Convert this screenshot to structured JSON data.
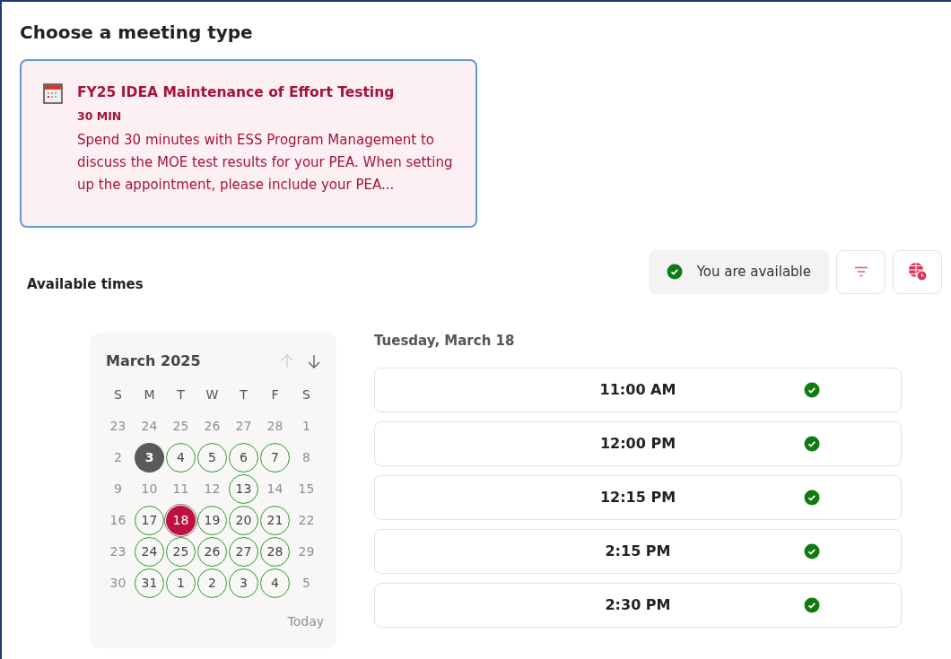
{
  "heading": "Choose a meeting type",
  "meeting_type": {
    "title": "FY25 IDEA Maintenance of Effort Testing",
    "duration": "30 MIN",
    "description": "Spend 30 minutes with ESS Program Management to discuss the MOE test results for your PEA. When setting up the appointment, please include your PEA...",
    "selected": true
  },
  "available_times_label": "Available times",
  "availability_status": "You are available",
  "calendar": {
    "month": "March 2025",
    "prev_disabled": true,
    "weekdays": [
      "S",
      "M",
      "T",
      "W",
      "T",
      "F",
      "S"
    ],
    "weeks": [
      [
        {
          "day": "23",
          "kind": "unavailable"
        },
        {
          "day": "24",
          "kind": "unavailable"
        },
        {
          "day": "25",
          "kind": "unavailable"
        },
        {
          "day": "26",
          "kind": "unavailable"
        },
        {
          "day": "27",
          "kind": "unavailable"
        },
        {
          "day": "28",
          "kind": "unavailable"
        },
        {
          "day": "1",
          "kind": "unavailable"
        }
      ],
      [
        {
          "day": "2",
          "kind": "unavailable"
        },
        {
          "day": "3",
          "kind": "today"
        },
        {
          "day": "4",
          "kind": "available"
        },
        {
          "day": "5",
          "kind": "available"
        },
        {
          "day": "6",
          "kind": "available"
        },
        {
          "day": "7",
          "kind": "available"
        },
        {
          "day": "8",
          "kind": "unavailable"
        }
      ],
      [
        {
          "day": "9",
          "kind": "unavailable"
        },
        {
          "day": "10",
          "kind": "unavailable"
        },
        {
          "day": "11",
          "kind": "unavailable"
        },
        {
          "day": "12",
          "kind": "unavailable"
        },
        {
          "day": "13",
          "kind": "available"
        },
        {
          "day": "14",
          "kind": "unavailable"
        },
        {
          "day": "15",
          "kind": "unavailable"
        }
      ],
      [
        {
          "day": "16",
          "kind": "unavailable"
        },
        {
          "day": "17",
          "kind": "available"
        },
        {
          "day": "18",
          "kind": "selected"
        },
        {
          "day": "19",
          "kind": "available"
        },
        {
          "day": "20",
          "kind": "available"
        },
        {
          "day": "21",
          "kind": "available"
        },
        {
          "day": "22",
          "kind": "unavailable"
        }
      ],
      [
        {
          "day": "23",
          "kind": "unavailable"
        },
        {
          "day": "24",
          "kind": "available"
        },
        {
          "day": "25",
          "kind": "available"
        },
        {
          "day": "26",
          "kind": "available"
        },
        {
          "day": "27",
          "kind": "available"
        },
        {
          "day": "28",
          "kind": "available"
        },
        {
          "day": "29",
          "kind": "unavailable"
        }
      ],
      [
        {
          "day": "30",
          "kind": "unavailable"
        },
        {
          "day": "31",
          "kind": "available"
        },
        {
          "day": "1",
          "kind": "available"
        },
        {
          "day": "2",
          "kind": "available"
        },
        {
          "day": "3",
          "kind": "available"
        },
        {
          "day": "4",
          "kind": "available"
        },
        {
          "day": "5",
          "kind": "unavailable"
        }
      ]
    ],
    "today_label": "Today",
    "today_disabled": true
  },
  "selected_date": "Tuesday, March 18",
  "time_slots": [
    {
      "time": "11:00 AM",
      "available": true
    },
    {
      "time": "12:00 PM",
      "available": true
    },
    {
      "time": "12:15 PM",
      "available": true
    },
    {
      "time": "2:15 PM",
      "available": true
    },
    {
      "time": "2:30 PM",
      "available": true
    }
  ]
}
